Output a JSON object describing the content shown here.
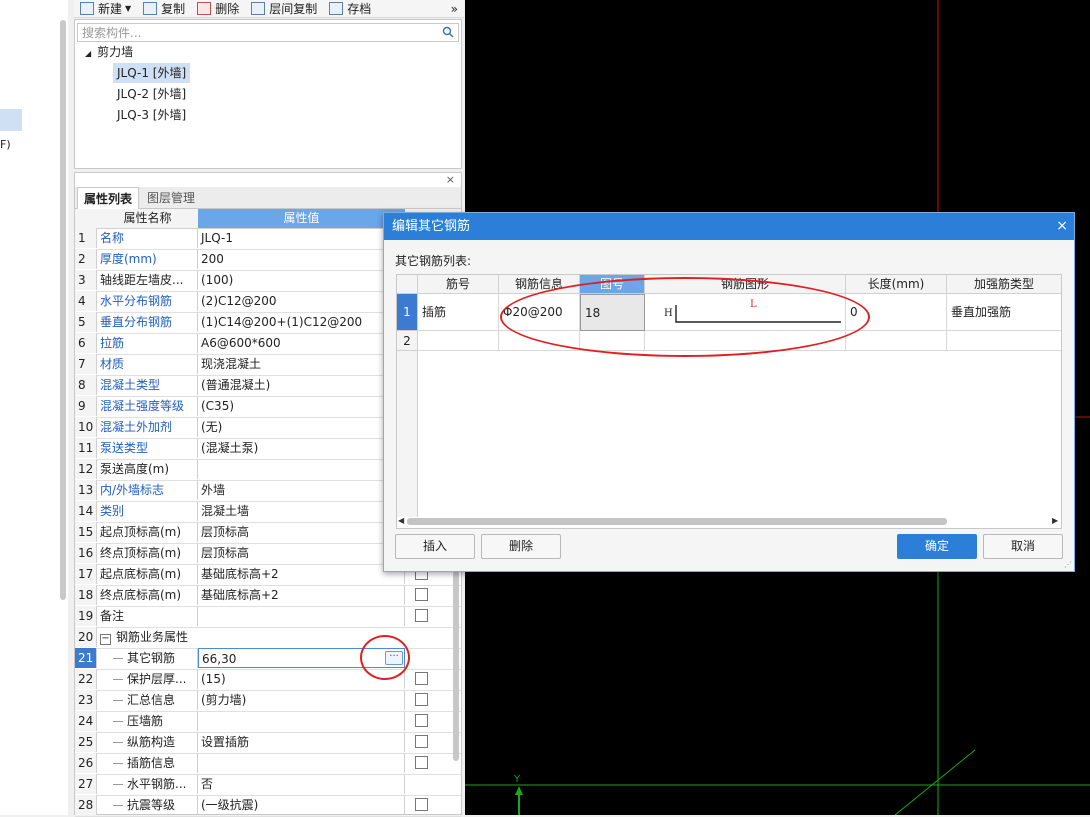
{
  "left_panel": {
    "fragment": "F)"
  },
  "toolbar": {
    "new_label": "新建",
    "copy_label": "复制",
    "delete_label": "删除",
    "floor_copy_label": "层间复制",
    "save_label": "存档",
    "more": "»"
  },
  "component_panel": {
    "search_placeholder": "搜索构件...",
    "group": "剪力墙",
    "items": [
      "JLQ-1 [外墙]",
      "JLQ-2 [外墙]",
      "JLQ-3 [外墙]"
    ],
    "selected_index": 0
  },
  "properties_panel": {
    "close": "×",
    "tabs": [
      "属性列表",
      "图层管理"
    ],
    "header": {
      "name": "属性名称",
      "value": "属性值"
    },
    "rows": [
      {
        "num": "1",
        "name": "名称",
        "value": "JLQ-1"
      },
      {
        "num": "2",
        "name": "厚度(mm)",
        "value": "200"
      },
      {
        "num": "3",
        "name": "轴线距左墙皮...",
        "value": "(100)"
      },
      {
        "num": "4",
        "name": "水平分布钢筋",
        "value": "(2)C12@200"
      },
      {
        "num": "5",
        "name": "垂直分布钢筋",
        "value": "(1)C14@200+(1)C12@200"
      },
      {
        "num": "6",
        "name": "拉筋",
        "value": "A6@600*600"
      },
      {
        "num": "7",
        "name": "材质",
        "value": "现浇混凝土"
      },
      {
        "num": "8",
        "name": "混凝土类型",
        "value": "(普通混凝土)"
      },
      {
        "num": "9",
        "name": "混凝土强度等级",
        "value": "(C35)"
      },
      {
        "num": "10",
        "name": "混凝土外加剂",
        "value": "(无)"
      },
      {
        "num": "11",
        "name": "泵送类型",
        "value": "(混凝土泵)"
      },
      {
        "num": "12",
        "name": "泵送高度(m)",
        "value": ""
      },
      {
        "num": "13",
        "name": "内/外墙标志",
        "value": "外墙"
      },
      {
        "num": "14",
        "name": "类别",
        "value": "混凝土墙"
      },
      {
        "num": "15",
        "name": "起点顶标高(m)",
        "value": "层顶标高"
      },
      {
        "num": "16",
        "name": "终点顶标高(m)",
        "value": "层顶标高"
      },
      {
        "num": "17",
        "name": "起点底标高(m)",
        "value": "基础底标高+2"
      },
      {
        "num": "18",
        "name": "终点底标高(m)",
        "value": "基础底标高+2"
      },
      {
        "num": "19",
        "name": "备注",
        "value": ""
      },
      {
        "num": "20",
        "name": "钢筋业务属性",
        "value": "",
        "expander": "−"
      },
      {
        "num": "21",
        "name": "其它钢筋",
        "value": "66,30"
      },
      {
        "num": "22",
        "name": "保护层厚...",
        "value": "(15)"
      },
      {
        "num": "23",
        "name": "汇总信息",
        "value": "(剪力墙)"
      },
      {
        "num": "24",
        "name": "压墙筋",
        "value": ""
      },
      {
        "num": "25",
        "name": "纵筋构造",
        "value": "设置插筋"
      },
      {
        "num": "26",
        "name": "插筋信息",
        "value": ""
      },
      {
        "num": "27",
        "name": "水平钢筋...",
        "value": "否"
      },
      {
        "num": "28",
        "name": "抗震等级",
        "value": "(一级抗震)"
      }
    ],
    "ellipsis": "···"
  },
  "canvas": {
    "axis_label_y": "Y"
  },
  "dialog": {
    "title": "编辑其它钢筋",
    "close": "×",
    "list_label": "其它钢筋列表:",
    "columns": [
      "筋号",
      "钢筋信息",
      "图号",
      "钢筋图形",
      "长度(mm)",
      "加强筋类型"
    ],
    "rows": [
      {
        "num": "1",
        "bar_no": "插筋",
        "bar_info": "Φ20@200",
        "fig_no": "18",
        "shape_h": "H",
        "shape_l": "L",
        "length": "0",
        "type": "垂直加强筋"
      },
      {
        "num": "2",
        "bar_no": "",
        "bar_info": "",
        "fig_no": "",
        "shape_h": "",
        "shape_l": "",
        "length": "",
        "type": ""
      }
    ],
    "buttons": {
      "insert": "插入",
      "delete": "删除",
      "ok": "确定",
      "cancel": "取消"
    }
  },
  "colors": {
    "accent": "#2b7fd8",
    "annotation": "#e02020",
    "grid_red": "#c81010",
    "grid_green": "#1aa81a"
  }
}
